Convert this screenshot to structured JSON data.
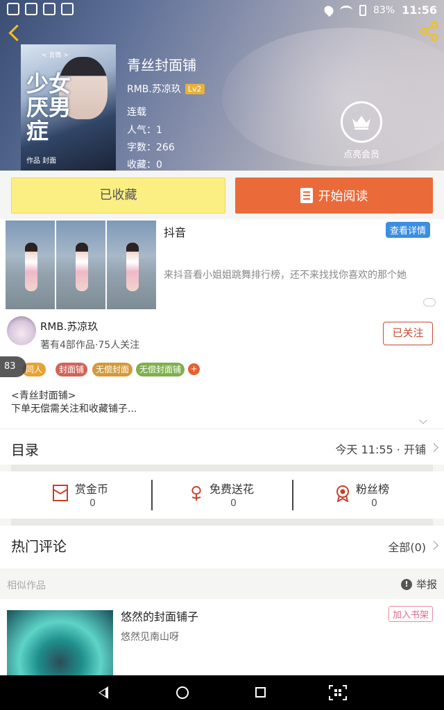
{
  "status_bar": {
    "battery": "83%",
    "time": "11:56"
  },
  "book": {
    "title": "青丝封面铺",
    "author": "RMB.苏凉玖",
    "level": "Lv2",
    "status": "连载",
    "popularity": "人气：1",
    "word_count": "字数：266",
    "collections": "收藏：0",
    "cover": {
      "title": "少女厌男症",
      "subtitle": "作品 封面",
      "tag": "< 言情 >"
    }
  },
  "vip": {
    "label": "点亮会员"
  },
  "actions": {
    "favorited_label": "已收藏",
    "read_label": "开始阅读"
  },
  "ad": {
    "title": "抖音",
    "detail_label": "查看详情",
    "description": "来抖音看小姐姐跳舞排行榜，还不来找找你喜欢的那个她"
  },
  "author_card": {
    "name": "RMB.苏凉玖",
    "meta": "著有4部作品·75人关注",
    "follow_label": "已关注"
  },
  "overlay_badge": "83",
  "tags": [
    {
      "label": "同人",
      "color": "#e8a235"
    },
    {
      "label": "封面铺",
      "color": "#d0645a"
    },
    {
      "label": "无偿封面",
      "color": "#d39a3a"
    },
    {
      "label": "无偿封面铺",
      "color": "#7fb04c"
    }
  ],
  "tag_add_label": "+",
  "intro": {
    "line1": "<青丝封面铺>",
    "line2": "下单无偿需关注和收藏铺子..."
  },
  "catalog": {
    "title": "目录",
    "latest": "今天 11:55 · 开铺"
  },
  "stats": [
    {
      "label": "赏金币",
      "value": "0",
      "icon": "red-packet-icon"
    },
    {
      "label": "免费送花",
      "value": "0",
      "icon": "flower-icon"
    },
    {
      "label": "粉丝榜",
      "value": "0",
      "icon": "medal-icon"
    }
  ],
  "comments": {
    "title": "热门评论",
    "all_label": "全部(0)"
  },
  "similar": {
    "section_label": "相似作品",
    "report_label": "举报"
  },
  "similar_item": {
    "title": "悠然的封面铺子",
    "author": "悠然见南山呀",
    "add_label": "加入书架"
  }
}
